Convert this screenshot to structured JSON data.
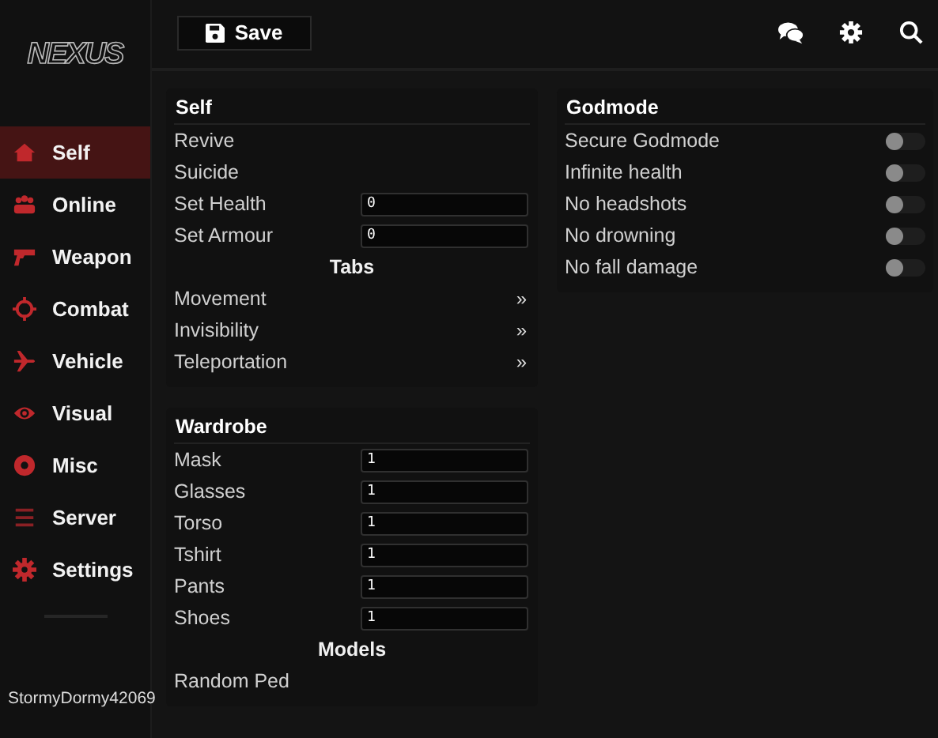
{
  "logo": "NEXUS",
  "sidebar": {
    "items": [
      {
        "label": "Self",
        "selected": true
      },
      {
        "label": "Online",
        "selected": false
      },
      {
        "label": "Weapon",
        "selected": false
      },
      {
        "label": "Combat",
        "selected": false
      },
      {
        "label": "Vehicle",
        "selected": false
      },
      {
        "label": "Visual",
        "selected": false
      },
      {
        "label": "Misc",
        "selected": false
      },
      {
        "label": "Server",
        "selected": false
      },
      {
        "label": "Settings",
        "selected": false
      }
    ],
    "username": "StormyDormy42069"
  },
  "toolbar": {
    "save_button": "Save"
  },
  "panels": [
    {
      "title": "Self",
      "rows": [
        {
          "kind": "action",
          "label": "Revive"
        },
        {
          "kind": "action",
          "label": "Suicide"
        },
        {
          "kind": "input",
          "label": "Set Health",
          "value": "0"
        },
        {
          "kind": "input",
          "label": "Set Armour",
          "value": "0"
        },
        {
          "kind": "heading",
          "label": "Tabs"
        },
        {
          "kind": "submenu",
          "label": "Movement",
          "arrow": "»"
        },
        {
          "kind": "submenu",
          "label": "Invisibility",
          "arrow": "»"
        },
        {
          "kind": "submenu",
          "label": "Teleportation",
          "arrow": "»"
        }
      ]
    },
    {
      "title": "Wardrobe",
      "rows": [
        {
          "kind": "input",
          "label": "Mask",
          "value": "1"
        },
        {
          "kind": "input",
          "label": "Glasses",
          "value": "1"
        },
        {
          "kind": "input",
          "label": "Torso",
          "value": "1"
        },
        {
          "kind": "input",
          "label": "Tshirt",
          "value": "1"
        },
        {
          "kind": "input",
          "label": "Pants",
          "value": "1"
        },
        {
          "kind": "input",
          "label": "Shoes",
          "value": "1"
        },
        {
          "kind": "heading",
          "label": "Models"
        },
        {
          "kind": "action",
          "label": "Random Ped"
        }
      ]
    },
    {
      "title": "Godmode",
      "rows": [
        {
          "kind": "toggle",
          "label": "Secure Godmode",
          "on": false
        },
        {
          "kind": "toggle",
          "label": "Infinite health",
          "on": false
        },
        {
          "kind": "toggle",
          "label": "No headshots",
          "on": false
        },
        {
          "kind": "toggle",
          "label": "No drowning",
          "on": false
        },
        {
          "kind": "toggle",
          "label": "No fall damage",
          "on": false
        }
      ]
    }
  ]
}
